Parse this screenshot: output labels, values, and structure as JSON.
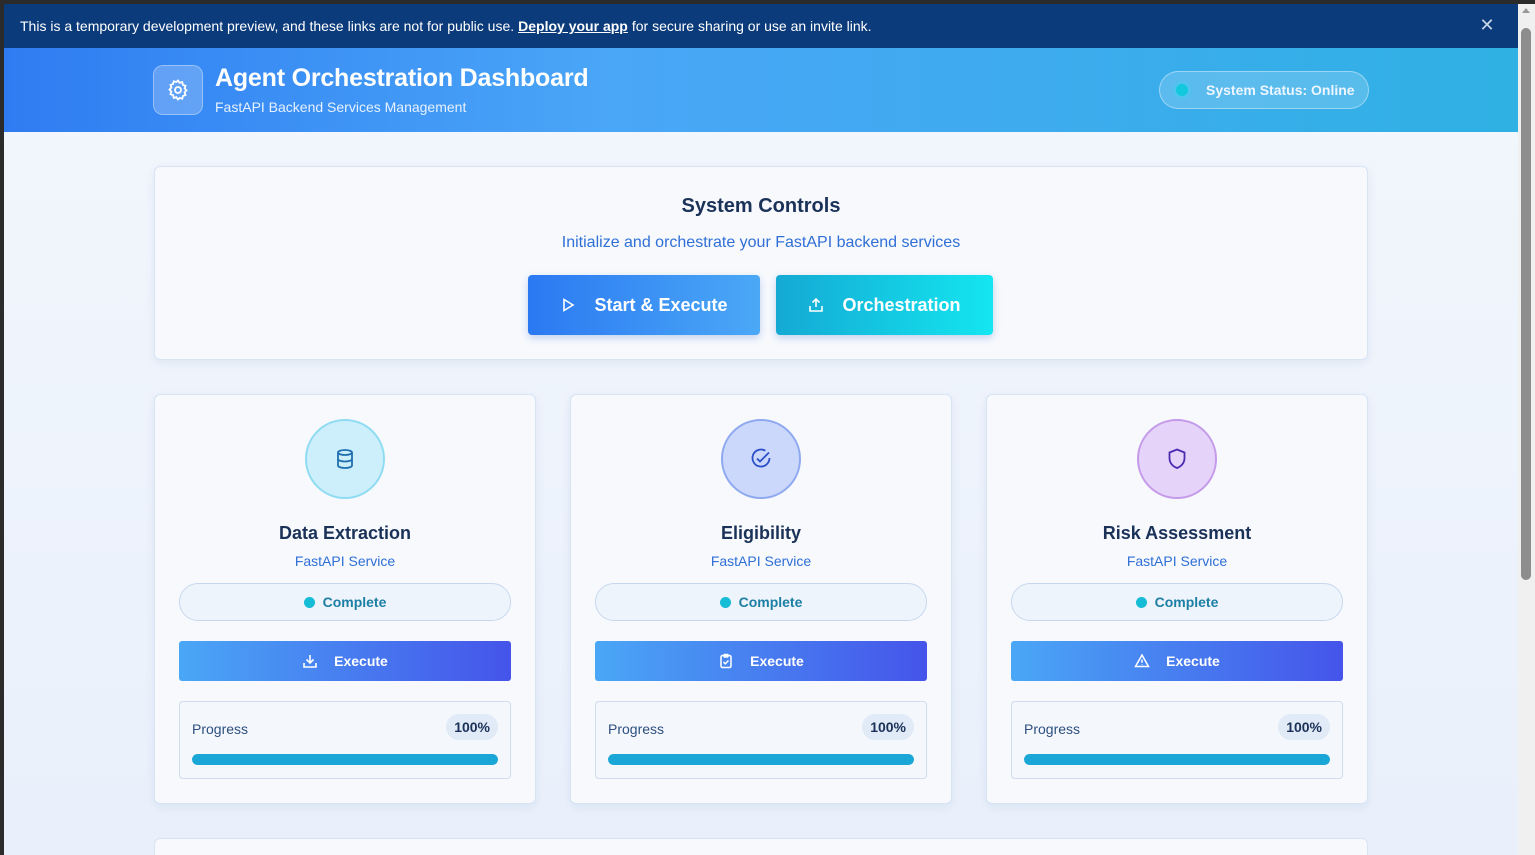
{
  "banner": {
    "text_before": "This is a temporary development preview, and these links are not for public use.",
    "link": "Deploy your app",
    "text_after": "for secure sharing or use an invite link."
  },
  "header": {
    "title": "Agent Orchestration Dashboard",
    "subtitle": "FastAPI Backend Services Management",
    "status": "System Status: Online"
  },
  "controls": {
    "title": "System Controls",
    "description": "Initialize and orchestrate your FastAPI backend services",
    "start_label": "Start & Execute",
    "orchestration_label": "Orchestration"
  },
  "services": [
    {
      "title": "Data Extraction",
      "subtitle": "FastAPI Service",
      "status": "Complete",
      "execute_label": "Execute",
      "progress_label": "Progress",
      "progress_text": "100%",
      "progress": 1.0,
      "icon": "database-icon"
    },
    {
      "title": "Eligibility",
      "subtitle": "FastAPI Service",
      "status": "Complete",
      "execute_label": "Execute",
      "progress_label": "Progress",
      "progress_text": "100%",
      "progress": 1.0,
      "icon": "check-circle-icon"
    },
    {
      "title": "Risk Assessment",
      "subtitle": "FastAPI Service",
      "status": "Complete",
      "execute_label": "Execute",
      "progress_label": "Progress",
      "progress_text": "100%",
      "progress": 1.0,
      "icon": "shield-icon"
    }
  ],
  "colors": {
    "banner": "#0b3b7a",
    "accent": "#2f7cf2",
    "status_dot": "#14bcd6",
    "progress_fill": "#1aa6d6"
  }
}
